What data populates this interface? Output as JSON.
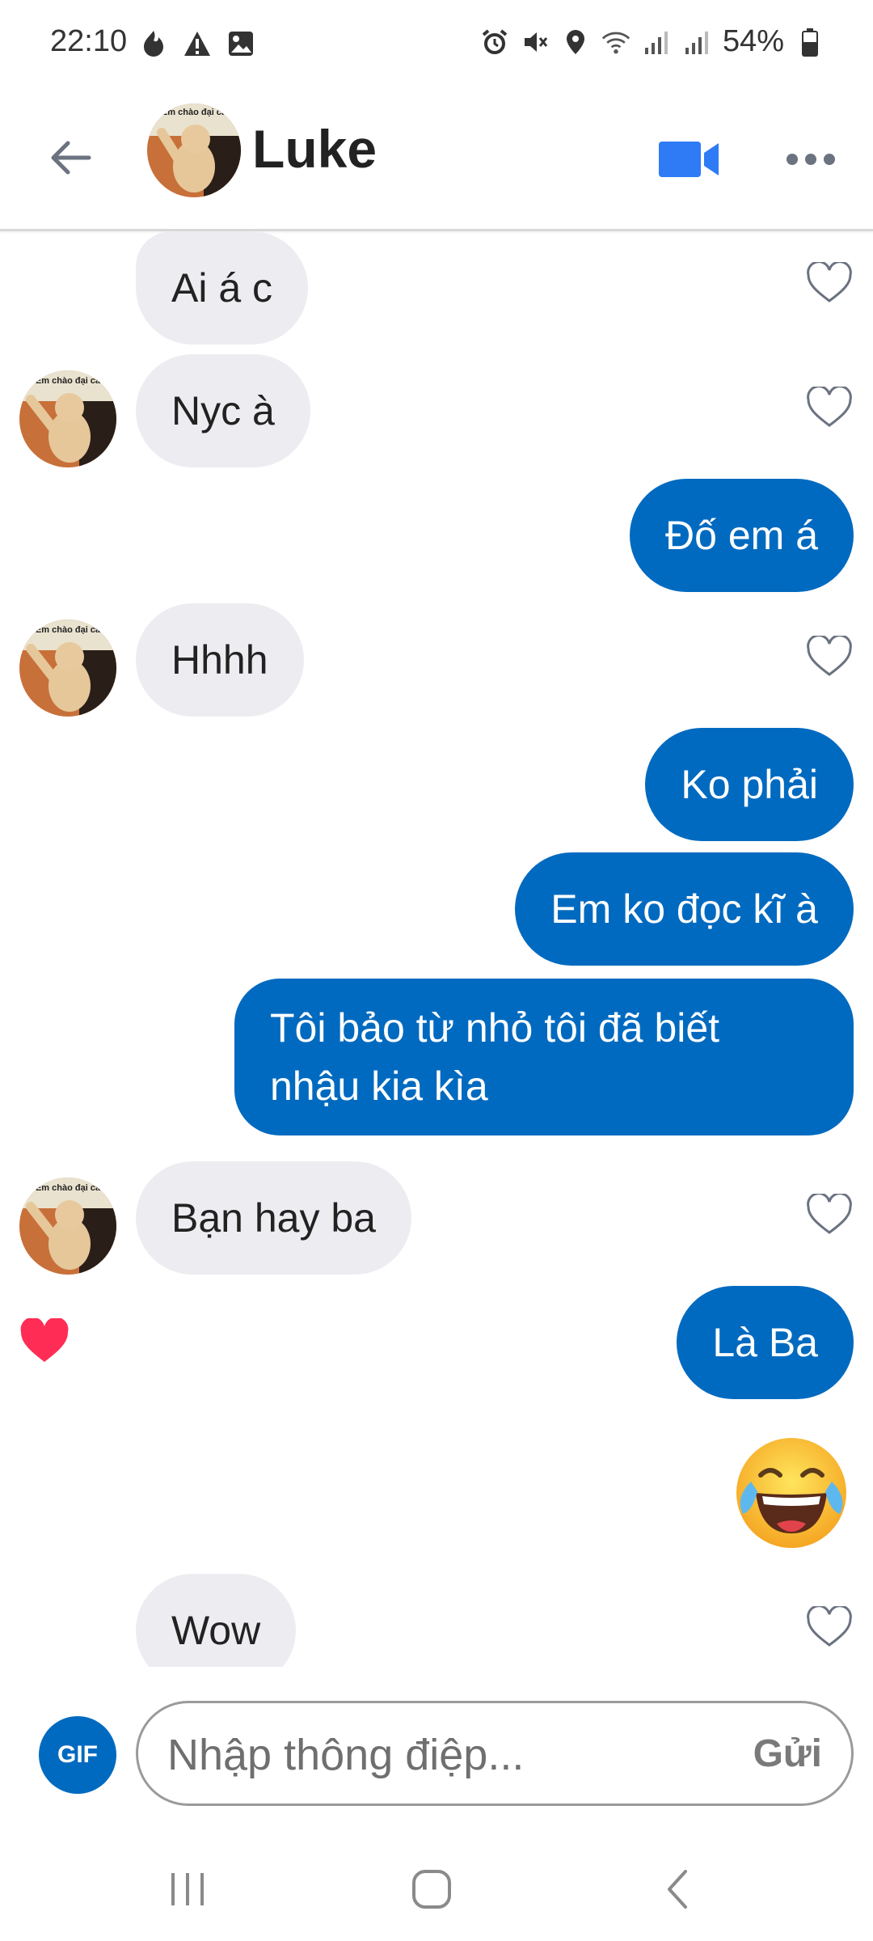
{
  "status_bar": {
    "time": "22:10",
    "battery": "54%"
  },
  "header": {
    "name": "Luke",
    "avatar_caption": "Em chào đại ca"
  },
  "messages": [
    {
      "side": "in",
      "text": "Ai á c"
    },
    {
      "side": "in",
      "text": "Nyc à"
    },
    {
      "side": "out",
      "text": "Đố em á"
    },
    {
      "side": "in",
      "text": "Hhhh"
    },
    {
      "side": "out",
      "text": "Ko phải"
    },
    {
      "side": "out",
      "text": "Em ko đọc kĩ à"
    },
    {
      "side": "out",
      "text": "Tôi bảo từ nhỏ tôi đã biết nhậu kia kìa"
    },
    {
      "side": "in",
      "text": "Bạn hay ba"
    },
    {
      "side": "out",
      "text": "Là Ba",
      "liked": true
    },
    {
      "side": "out",
      "emoji": "face-with-tears-of-joy"
    },
    {
      "side": "in",
      "text": "Wow"
    }
  ],
  "composer": {
    "gif_label": "GIF",
    "placeholder": "Nhập thông điệp...",
    "send_label": "Gửi"
  },
  "colors": {
    "outgoing_bubble": "#006ac0",
    "incoming_bubble": "#ededf1",
    "like_heart": "#ff2d55",
    "video_icon": "#2f7bf5"
  }
}
